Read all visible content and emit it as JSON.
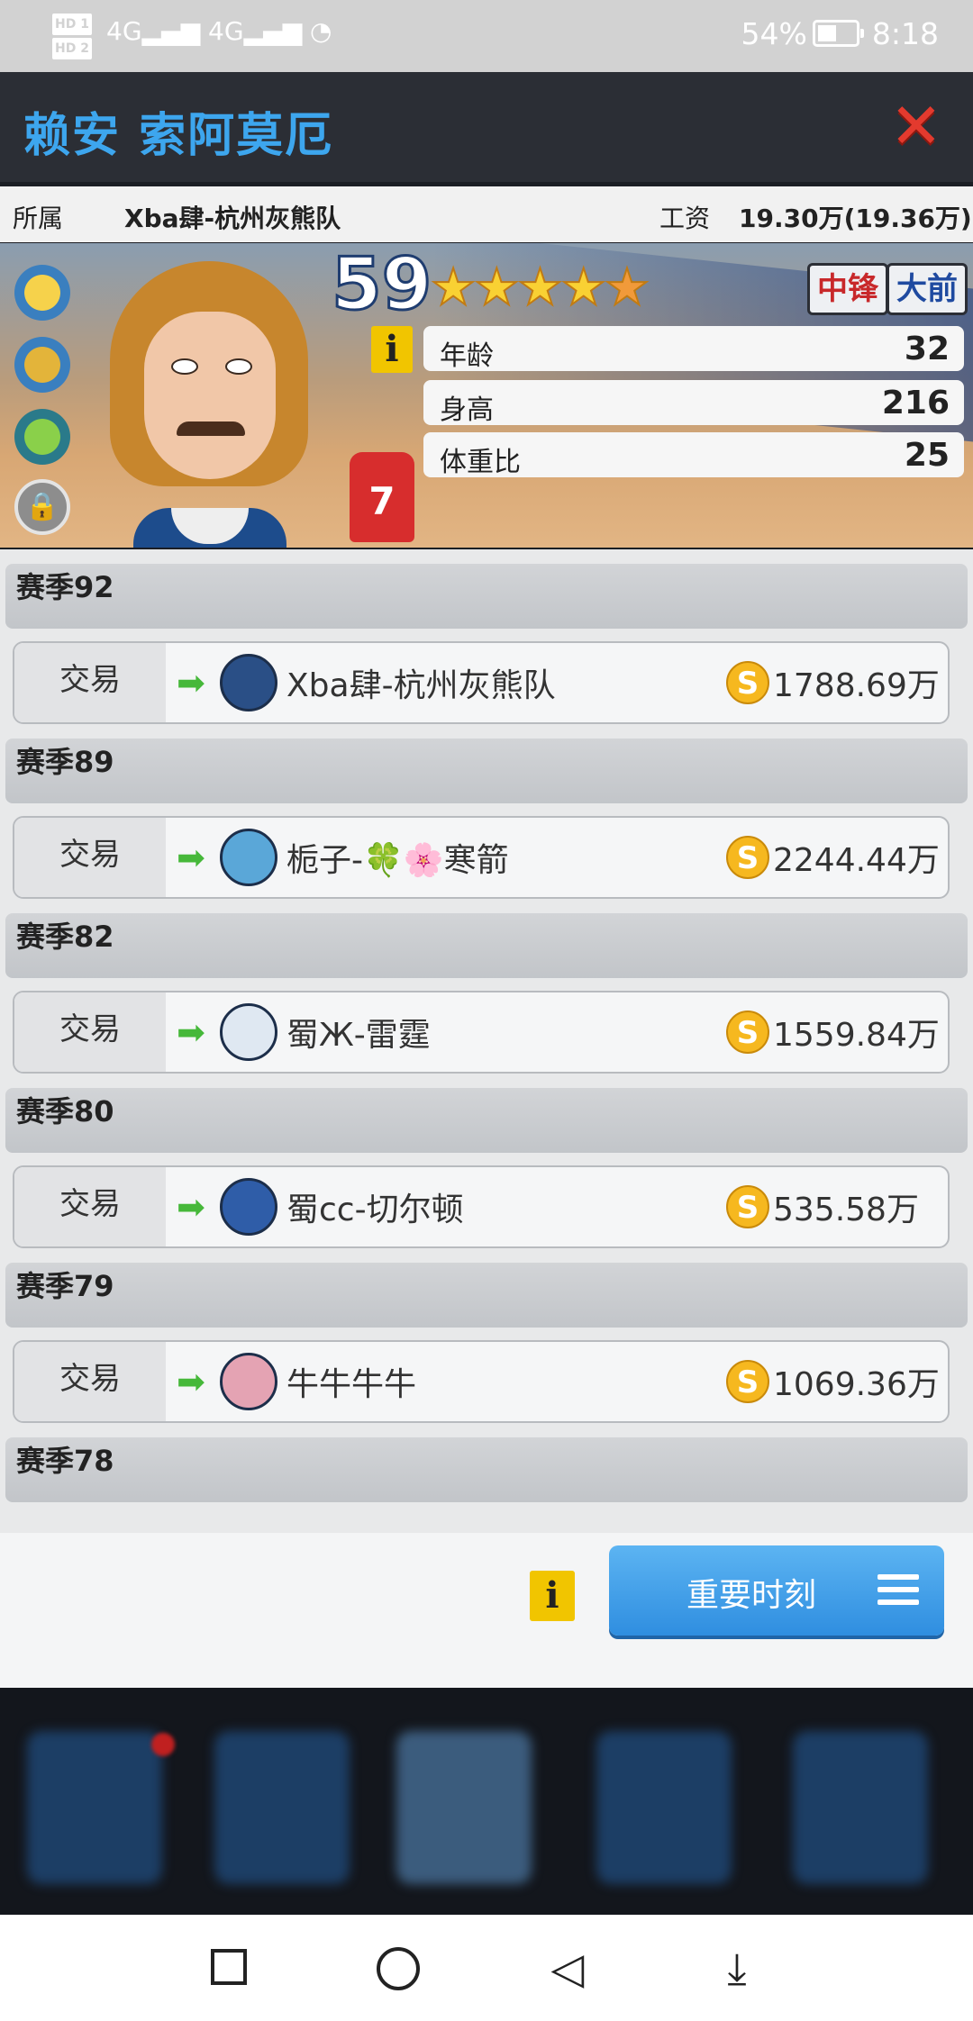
{
  "status_bar": {
    "sim1": "HD 1",
    "sim2": "HD 2",
    "signal_text": "4G",
    "battery": "54%",
    "time": "8:18"
  },
  "title_bar": {
    "player_name": "赖安 索阿莫厄",
    "close_icon": "close-x-icon"
  },
  "affiliation": {
    "label": "所属",
    "team": "Xba肆-杭州灰熊队",
    "salary_label": "工资",
    "salary": "19.30万(19.36万)"
  },
  "player_card": {
    "rating": "59",
    "stars": 4.5,
    "positions": [
      "中锋",
      "大前"
    ],
    "jersey_number": "7",
    "info_icon": "i",
    "attributes": [
      {
        "key": "年龄",
        "value": "32"
      },
      {
        "key": "身高",
        "value": "216"
      },
      {
        "key": "体重比",
        "value": "25"
      }
    ]
  },
  "history": [
    {
      "season": "赛季92",
      "type": "交易",
      "team": "Xba肆-杭州灰熊队",
      "amount": "1788.69万",
      "logo_color": "#2a4f86"
    },
    {
      "season": "赛季89",
      "type": "交易",
      "team": "栀子-🍀🌸寒箭",
      "amount": "2244.44万",
      "logo_color": "#5aa7d8"
    },
    {
      "season": "赛季82",
      "type": "交易",
      "team": "蜀Ж-雷霆",
      "amount": "1559.84万",
      "logo_color": "#dfe8f2"
    },
    {
      "season": "赛季80",
      "type": "交易",
      "team": "蜀cc-切尔顿",
      "amount": "535.58万",
      "logo_color": "#2f5da8"
    },
    {
      "season": "赛季79",
      "type": "交易",
      "team": "牛牛牛牛",
      "amount": "1069.36万",
      "logo_color": "#e4a3b3"
    }
  ],
  "history_trailing_season": "赛季78",
  "footer": {
    "info_icon": "i",
    "moments_button": "重要时刻"
  },
  "colors": {
    "title": "#3da6ee",
    "close": "#e33a2e",
    "button": "#2f8ee0",
    "arrow": "#46b83a",
    "coin": "#f6b81f"
  }
}
